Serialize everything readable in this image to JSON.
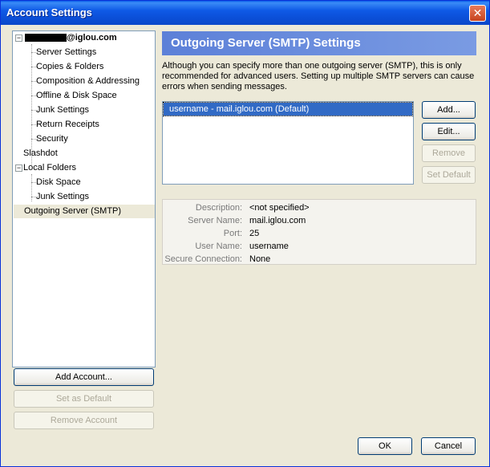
{
  "window": {
    "title": "Account Settings"
  },
  "tree": {
    "account": {
      "email_suffix": "@iglou.com",
      "expander": "−"
    },
    "account_children": [
      "Server Settings",
      "Copies & Folders",
      "Composition & Addressing",
      "Offline & Disk Space",
      "Junk Settings",
      "Return Receipts",
      "Security"
    ],
    "slashdot": "Slashdot",
    "local_folders": {
      "label": "Local Folders",
      "expander": "−"
    },
    "local_children": [
      "Disk Space",
      "Junk Settings"
    ],
    "outgoing": "Outgoing Server (SMTP)"
  },
  "left_buttons": {
    "add_account": "Add Account...",
    "set_default": "Set as Default",
    "remove_account": "Remove Account"
  },
  "panel": {
    "title": "Outgoing Server (SMTP) Settings",
    "description": "Although you can specify more than one outgoing server (SMTP), this is only recommended for advanced users. Setting up multiple SMTP servers can cause errors when sending messages.",
    "servers": [
      "username - mail.iglou.com (Default)"
    ],
    "buttons": {
      "add": "Add...",
      "edit": "Edit...",
      "remove": "Remove",
      "set_default": "Set Default"
    },
    "details": {
      "description_label": "Description:",
      "description_value": "<not specified>",
      "server_name_label": "Server Name:",
      "server_name_value": "mail.iglou.com",
      "port_label": "Port:",
      "port_value": "25",
      "user_name_label": "User Name:",
      "user_name_value": "username",
      "secure_label": "Secure Connection:",
      "secure_value": "None"
    }
  },
  "footer": {
    "ok": "OK",
    "cancel": "Cancel"
  },
  "icons": {
    "close": "close-icon"
  }
}
